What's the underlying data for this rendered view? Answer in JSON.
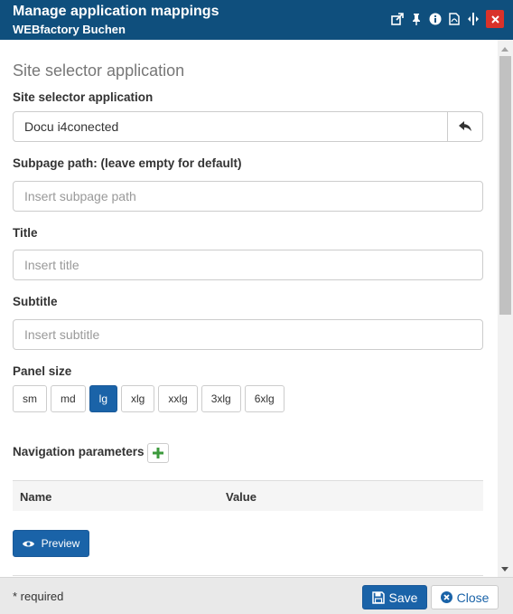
{
  "header": {
    "title": "Manage application mappings",
    "subtitle": "WEBfactory Buchen",
    "icons": [
      "external-link-icon",
      "pin-icon",
      "info-icon",
      "pdf-icon",
      "resize-icon",
      "close-icon"
    ]
  },
  "form": {
    "section_title": "Site selector application",
    "site_selector_label": "Site selector application",
    "site_selector_value": "Docu i4conected",
    "subpage_label": "Subpage path: (leave empty for default)",
    "subpage_placeholder": "Insert subpage path",
    "title_label": "Title",
    "title_placeholder": "Insert title",
    "subtitle_label": "Subtitle",
    "subtitle_placeholder": "Insert subtitle",
    "panel_size_label": "Panel size",
    "panel_sizes": [
      "sm",
      "md",
      "lg",
      "xlg",
      "xxlg",
      "3xlg",
      "6xlg"
    ],
    "panel_size_selected": "lg",
    "nav_params_label": "Navigation parameters",
    "table_columns": [
      "Name",
      "Value"
    ],
    "preview_label": "Preview"
  },
  "footer": {
    "required_note": "* required",
    "save_label": "Save",
    "close_label": "Close"
  },
  "colors": {
    "header_bg": "#0f4f7d",
    "primary": "#1a63a8",
    "danger": "#d9322a",
    "add_green": "#3c9a3c",
    "footer_bg": "#e9e9e9"
  }
}
